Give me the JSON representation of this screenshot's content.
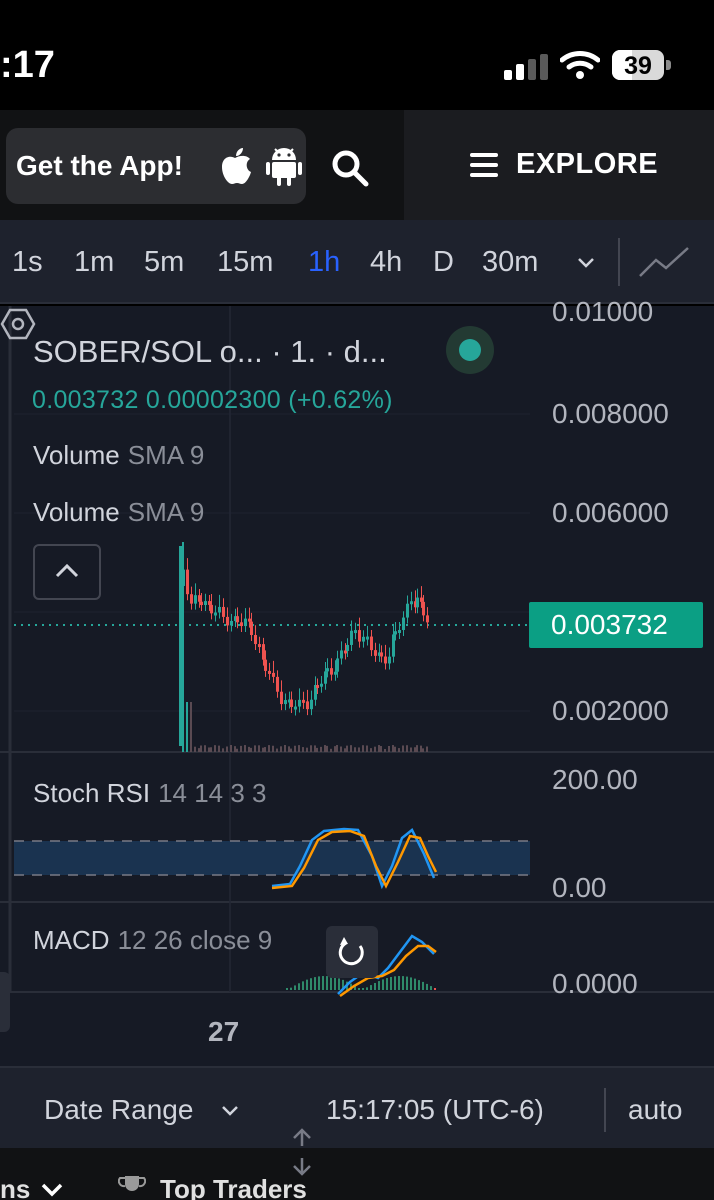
{
  "status_bar": {
    "time": ":17",
    "battery": "39",
    "battery_level": 0.39
  },
  "top_nav": {
    "get_app_label": "Get the App!",
    "explore_label": "EXPLORE"
  },
  "timeframes": [
    {
      "label": "1s",
      "active": false
    },
    {
      "label": "1m",
      "active": false
    },
    {
      "label": "5m",
      "active": false
    },
    {
      "label": "15m",
      "active": false
    },
    {
      "label": "1h",
      "active": true
    },
    {
      "label": "4h",
      "active": false
    },
    {
      "label": "D",
      "active": false
    },
    {
      "label": "30m",
      "active": false
    }
  ],
  "chart": {
    "symbol": "SOBER/SOL o... · 1. · d...",
    "ohlc": "0.003732  0.00002300  (+0.62%)",
    "indicators": [
      {
        "name": "Volume",
        "params": "SMA 9"
      },
      {
        "name": "Volume",
        "params": "SMA 9"
      }
    ],
    "stoch_rsi": {
      "name": "Stoch RSI",
      "params": "14 14 3 3"
    },
    "macd": {
      "name": "MACD",
      "params": "12 26 close 9"
    },
    "price_axis": [
      "0.01000",
      "0.008000",
      "0.006000",
      "0.002000"
    ],
    "current_price_tag": "0.003732",
    "stoch_axis": [
      "200.00",
      "0.00"
    ],
    "macd_axis": "0.0000",
    "time_label": "27",
    "colors": {
      "up": "#26a69a",
      "down": "#ef5350",
      "k_line": "#2196f3",
      "d_line": "#ff9800",
      "accent": "#2962ff"
    }
  },
  "bottom_bar": {
    "date_range_label": "Date Range",
    "clock": "15:17:05 (UTC-6)",
    "auto_label": "auto"
  },
  "bottom_strip": {
    "left_label": "ns",
    "top_traders_label": "Top Traders"
  }
}
